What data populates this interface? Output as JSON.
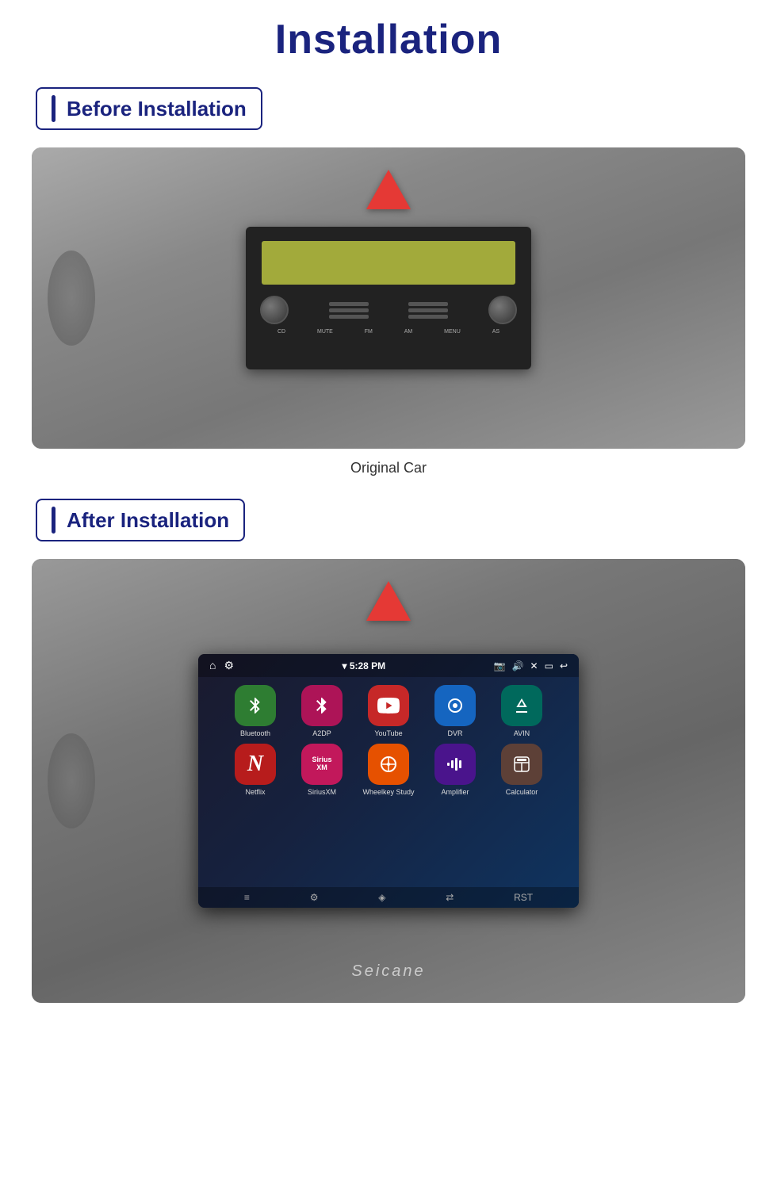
{
  "page": {
    "title": "Installation"
  },
  "before": {
    "badge_text": "Before Installation",
    "caption": "Original Car"
  },
  "after": {
    "badge_text": "After Installation"
  },
  "android_screen": {
    "status_time": "▾ 5:28 PM",
    "status_icons_right": "📷 🔊 ✕ ▭ ↩",
    "apps": [
      {
        "label": "Bluetooth",
        "icon": "bluetooth",
        "bg": "icon-bluetooth",
        "symbol": "𝔹"
      },
      {
        "label": "A2DP",
        "icon": "a2dp",
        "bg": "icon-a2dp",
        "symbol": "✱"
      },
      {
        "label": "YouTube",
        "icon": "youtube",
        "bg": "icon-youtube",
        "symbol": "▶"
      },
      {
        "label": "DVR",
        "icon": "dvr",
        "bg": "icon-dvr",
        "symbol": "⊚"
      },
      {
        "label": "AVIN",
        "icon": "avin",
        "bg": "icon-avin",
        "symbol": "⤵"
      },
      {
        "label": "Netflix",
        "icon": "netflix",
        "bg": "icon-netflix",
        "symbol": "N"
      },
      {
        "label": "SiriusXM",
        "icon": "sirius",
        "bg": "icon-sirius",
        "symbol": "〜"
      },
      {
        "label": "Wheelkey Study",
        "icon": "wheelkey",
        "bg": "icon-wheelkey",
        "symbol": "⊕"
      },
      {
        "label": "Amplifier",
        "icon": "amplifier",
        "bg": "icon-amplifier",
        "symbol": "▐▐"
      },
      {
        "label": "Calculator",
        "icon": "calculator",
        "bg": "icon-calculator",
        "symbol": "▦"
      }
    ],
    "brand": "Seicane"
  }
}
